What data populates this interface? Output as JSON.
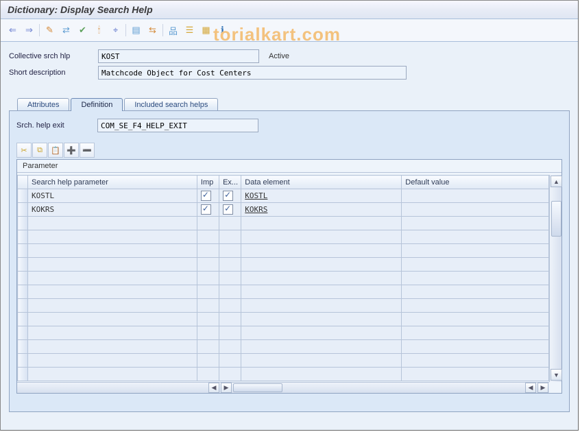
{
  "title": "Dictionary: Display Search Help",
  "watermark": "torialkart.com",
  "toolbar": [
    {
      "name": "back-icon",
      "glyph": "⇐",
      "color": "#6a7fcf"
    },
    {
      "name": "forward-icon",
      "glyph": "⇒",
      "color": "#6a7fcf"
    },
    {
      "sep": true
    },
    {
      "name": "display-change-icon",
      "glyph": "✎",
      "color": "#d58b3a"
    },
    {
      "name": "other-object-icon",
      "glyph": "⇄",
      "color": "#5f9dd2"
    },
    {
      "name": "check-icon",
      "glyph": "✔",
      "color": "#5fa25d"
    },
    {
      "name": "activate-icon",
      "glyph": "🕯",
      "color": "#d58b3a"
    },
    {
      "name": "where-used-icon",
      "glyph": "⌖",
      "color": "#6a7fcf"
    },
    {
      "sep": true
    },
    {
      "name": "display-list-icon",
      "glyph": "▤",
      "color": "#5f9dd2"
    },
    {
      "name": "hierarchy-icon",
      "glyph": "⇆",
      "color": "#d58b3a"
    },
    {
      "sep": true
    },
    {
      "name": "tree-icon",
      "glyph": "品",
      "color": "#5f9dd2"
    },
    {
      "name": "append-icon",
      "glyph": "☰",
      "color": "#d5a83a"
    },
    {
      "name": "documentation-icon",
      "glyph": "▦",
      "color": "#d5a83a"
    },
    {
      "name": "info-icon",
      "glyph": "ℹ",
      "color": "#2d6fb3"
    }
  ],
  "fields": {
    "collective_label": "Collective srch hlp",
    "collective_value": "KOST",
    "status": "Active",
    "shortdesc_label": "Short description",
    "shortdesc_value": "Matchcode Object for Cost Centers"
  },
  "tabs": {
    "attributes": "Attributes",
    "definition": "Definition",
    "included": "Included search helps"
  },
  "srch_exit_label": "Srch. help exit",
  "srch_exit_value": "COM_SE_F4_HELP_EXIT",
  "mini_toolbar": [
    {
      "name": "cut-icon",
      "glyph": "✂",
      "color": "#c9a227"
    },
    {
      "name": "copy-icon",
      "glyph": "⧉",
      "color": "#c9a227"
    },
    {
      "name": "paste-icon",
      "glyph": "📋",
      "color": "#8d97a9"
    },
    {
      "name": "insert-row-icon",
      "glyph": "➕",
      "color": "#5f9dd2"
    },
    {
      "name": "delete-row-icon",
      "glyph": "➖",
      "color": "#5f9dd2"
    }
  ],
  "grid": {
    "title": "Parameter",
    "columns": {
      "param": "Search help parameter",
      "imp": "Imp",
      "exp": "Ex...",
      "de": "Data element",
      "def": "Default value"
    },
    "rows": [
      {
        "param": "KOSTL",
        "imp": true,
        "exp": true,
        "de": "KOSTL",
        "def": ""
      },
      {
        "param": "KOKRS",
        "imp": true,
        "exp": true,
        "de": "KOKRS",
        "def": ""
      }
    ],
    "empty_rows": 12
  }
}
